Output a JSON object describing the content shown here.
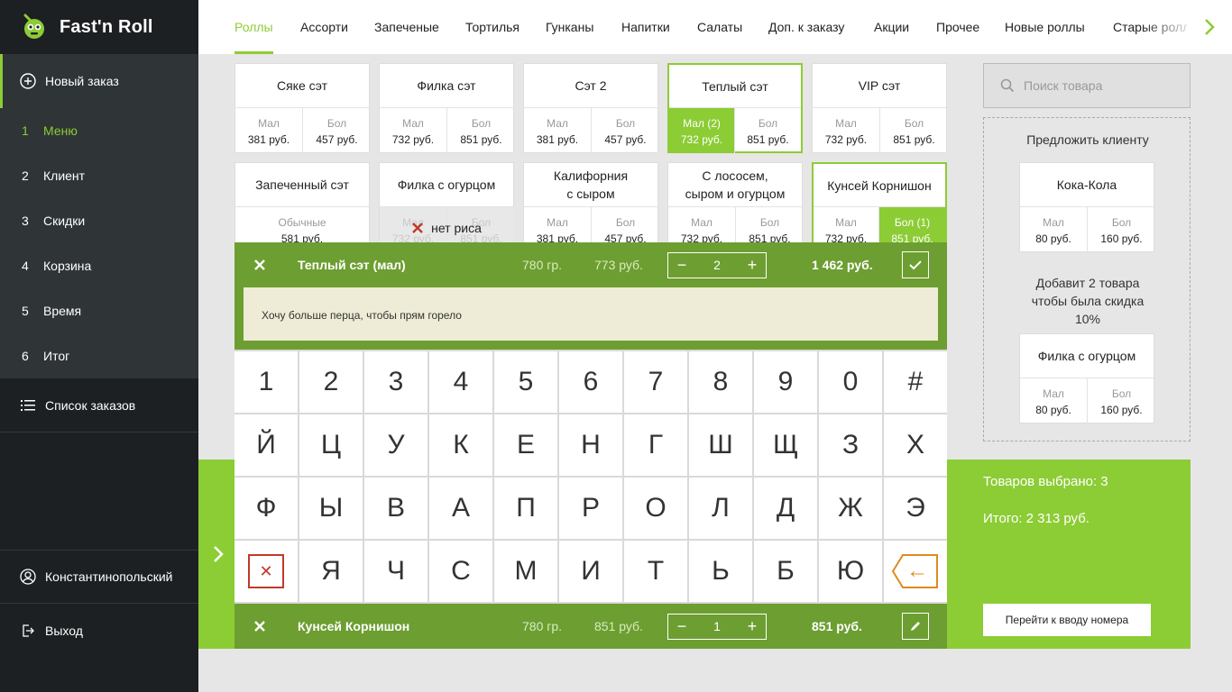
{
  "app": {
    "brand": "Fast'n Roll"
  },
  "sidebar": {
    "new_order": "Новый заказ",
    "steps": [
      {
        "num": "1",
        "label": "Меню",
        "active": true
      },
      {
        "num": "2",
        "label": "Клиент"
      },
      {
        "num": "3",
        "label": "Скидки"
      },
      {
        "num": "4",
        "label": "Корзина"
      },
      {
        "num": "5",
        "label": "Время"
      },
      {
        "num": "6",
        "label": "Итог"
      }
    ],
    "orders_list": "Список заказов",
    "user": "Константинопольский",
    "logout": "Выход"
  },
  "tabs": [
    "Роллы",
    "Ассорти",
    "Запеченые",
    "Тортилья",
    "Гунканы",
    "Напитки",
    "Салаты",
    "Доп. к заказу",
    "Акции",
    "Прочее",
    "Новые роллы",
    "Старые роллы"
  ],
  "products": [
    {
      "name": "Сяке сэт",
      "options": [
        {
          "size": "Мал",
          "price": "381 руб."
        },
        {
          "size": "Бол",
          "price": "457 руб."
        }
      ]
    },
    {
      "name": "Филка сэт",
      "options": [
        {
          "size": "Мал",
          "price": "732 руб."
        },
        {
          "size": "Бол",
          "price": "851 руб."
        }
      ]
    },
    {
      "name": "Сэт 2",
      "options": [
        {
          "size": "Мал",
          "price": "381 руб."
        },
        {
          "size": "Бол",
          "price": "457 руб."
        }
      ]
    },
    {
      "name": "Теплый сэт",
      "selected": true,
      "options": [
        {
          "size": "Мал (2)",
          "price": "732 руб.",
          "on": true
        },
        {
          "size": "Бол",
          "price": "851 руб."
        }
      ]
    },
    {
      "name": "VIP сэт",
      "options": [
        {
          "size": "Мал",
          "price": "732 руб."
        },
        {
          "size": "Бол",
          "price": "851 руб."
        }
      ]
    },
    {
      "name": "Запеченный сэт",
      "options": [
        {
          "size": "Обычные",
          "price": "581 руб."
        }
      ]
    },
    {
      "name": "Филка с огурцом",
      "unavailable": "нет риса",
      "options": [
        {
          "size": "Мал",
          "price": "732 руб."
        },
        {
          "size": "Бол",
          "price": "851 руб."
        }
      ]
    },
    {
      "name": "Калифорния\nс сыром",
      "options": [
        {
          "size": "Мал",
          "price": "381 руб."
        },
        {
          "size": "Бол",
          "price": "457 руб."
        }
      ]
    },
    {
      "name": "С лососем,\nсыром и огурцом",
      "options": [
        {
          "size": "Мал",
          "price": "732 руб."
        },
        {
          "size": "Бол",
          "price": "851 руб."
        }
      ]
    },
    {
      "name": "Кунсей Корнишон",
      "selected": true,
      "options": [
        {
          "size": "Мал",
          "price": "732 руб."
        },
        {
          "size": "Бол (1)",
          "price": "851 руб.",
          "on": true
        }
      ]
    }
  ],
  "editing_line": {
    "name": "Теплый сэт (мал)",
    "weight": "780 гр.",
    "unit_price": "773 руб.",
    "qty": "2",
    "total": "1 462 руб.",
    "comment": "Хочу больше перца, чтобы прям горело"
  },
  "second_line": {
    "name": "Кунсей Корнишон",
    "weight": "780 гр.",
    "unit_price": "851 руб.",
    "qty": "1",
    "total": "851 руб."
  },
  "keyboard": {
    "rows": [
      [
        "1",
        "2",
        "3",
        "4",
        "5",
        "6",
        "7",
        "8",
        "9",
        "0",
        "#"
      ],
      [
        "Й",
        "Ц",
        "У",
        "К",
        "Е",
        "Н",
        "Г",
        "Ш",
        "Щ",
        "З",
        "Х"
      ],
      [
        "Ф",
        "Ы",
        "В",
        "А",
        "П",
        "Р",
        "О",
        "Л",
        "Д",
        "Ж",
        "Э"
      ],
      [
        "✕",
        "Я",
        "Ч",
        "С",
        "М",
        "И",
        "Т",
        "Ь",
        "Б",
        "Ю",
        "←"
      ]
    ]
  },
  "summary": {
    "count": "Товаров выбрано: 3",
    "total": "Итого: 2 313 руб.",
    "phone_button": "Перейти к вводу номера"
  },
  "search": {
    "placeholder": "Поиск товара"
  },
  "suggest": {
    "title": "Предложить клиенту",
    "hint": "Добавит 2 товара\nчтобы была скидка\n10%",
    "items": [
      {
        "name": "Кока-Кола",
        "options": [
          {
            "size": "Мал",
            "price": "80 руб."
          },
          {
            "size": "Бол",
            "price": "160 руб."
          }
        ]
      },
      {
        "name": "Филка с огурцом",
        "options": [
          {
            "size": "Мал",
            "price": "80 руб."
          },
          {
            "size": "Бол",
            "price": "160 руб."
          }
        ]
      }
    ]
  },
  "colors": {
    "accent": "#8ccc35",
    "dark_green": "#6d9e31",
    "sidebar": "#1d2022",
    "danger": "#c0392b",
    "back_key": "#e08a1e"
  }
}
